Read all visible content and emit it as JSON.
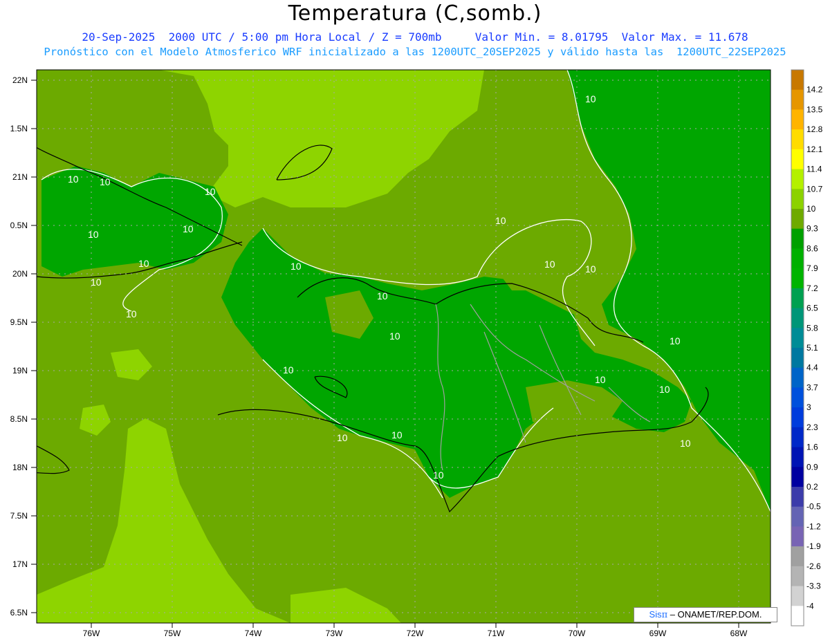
{
  "header": {
    "title": "Temperatura (C,somb.)",
    "line1": "20-Sep-2025  2000 UTC / 5:00 pm Hora Local / Z = 700mb     Valor Min. = 8.01795  Valor Max. = 11.678",
    "line2": "Pronóstico con el Modelo Atmosferico WRF inicializado a las 1200UTC_20SEP2025 y válido hasta las  1200UTC_22SEP2025"
  },
  "map": {
    "lat_labels": [
      "22N",
      "1.5N",
      "21N",
      "0.5N",
      "20N",
      "9.5N",
      "19N",
      "8.5N",
      "18N",
      "7.5N",
      "17N",
      "6.5N"
    ],
    "lon_labels": [
      "76W",
      "75W",
      "74W",
      "73W",
      "72W",
      "71W",
      "70W",
      "69W",
      "68W"
    ],
    "contour_labels": [
      "10",
      "10",
      "10",
      "10",
      "10",
      "10",
      "10",
      "10",
      "10",
      "10",
      "10",
      "10",
      "10",
      "10",
      "10",
      "10",
      "10",
      "10",
      "10",
      "10",
      "10",
      "10",
      "10"
    ],
    "fill_colors": {
      "light": "#8ed400",
      "mid": "#6caa00",
      "dark": "#00a600",
      "darker": "#009200"
    }
  },
  "colorbar": {
    "labels": [
      "14.2",
      "13.5",
      "12.8",
      "12.1",
      "11.4",
      "10.7",
      "10",
      "9.3",
      "8.6",
      "7.9",
      "7.2",
      "6.5",
      "5.8",
      "5.1",
      "4.4",
      "3.7",
      "3",
      "2.3",
      "1.6",
      "0.9",
      "0.2",
      "-0.5",
      "-1.2",
      "-1.9",
      "-2.6",
      "-3.3",
      "-4"
    ],
    "colors": [
      "#c87800",
      "#e69600",
      "#ffb400",
      "#ffdc00",
      "#ffff00",
      "#b4f000",
      "#8cd200",
      "#6eaa00",
      "#00a000",
      "#00b000",
      "#00b400",
      "#00a050",
      "#009678",
      "#008c96",
      "#0078a0",
      "#0064c8",
      "#0050dc",
      "#003cdc",
      "#0028c8",
      "#0014b4",
      "#0000a0",
      "#3c3caa",
      "#6464b4",
      "#7864b4",
      "#a0a0a0",
      "#b4b4b4",
      "#d2d2d2",
      "#ffffff"
    ]
  },
  "credit": {
    "sis": "Sis",
    "pi": "π",
    "rest": " – ONAMET/REP.DOM."
  }
}
